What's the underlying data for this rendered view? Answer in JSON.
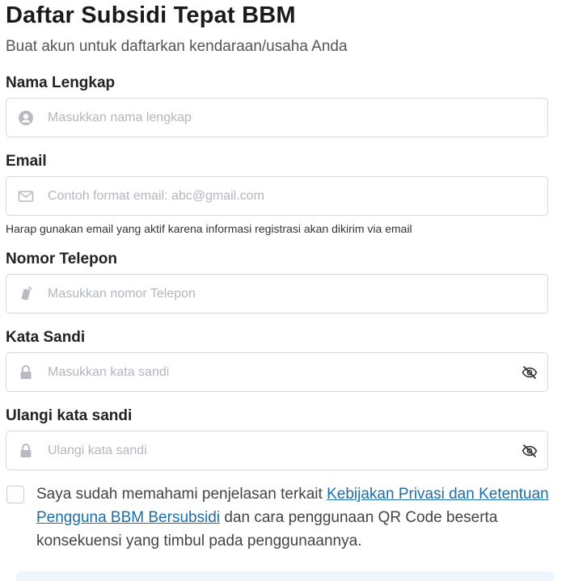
{
  "header": {
    "title": "Daftar Subsidi Tepat BBM",
    "subtitle": "Buat akun untuk daftarkan kendaraan/usaha Anda"
  },
  "form": {
    "full_name": {
      "label": "Nama Lengkap",
      "placeholder": "Masukkan nama lengkap",
      "icon": "user-circle-icon"
    },
    "email": {
      "label": "Email",
      "placeholder": "Contoh format email: abc@gmail.com",
      "icon": "envelope-icon",
      "hint": "Harap gunakan email yang aktif karena informasi registrasi akan dikirim via email"
    },
    "phone": {
      "label": "Nomor Telepon",
      "placeholder": "Masukkan nomor Telepon",
      "icon": "phone-icon"
    },
    "password": {
      "label": "Kata Sandi",
      "placeholder": "Masukkan kata sandi",
      "icon": "lock-icon",
      "toggle_icon": "eye-slash-icon"
    },
    "confirm_password": {
      "label": "Ulangi kata sandi",
      "placeholder": "Ulangi kata sandi",
      "icon": "lock-icon",
      "toggle_icon": "eye-slash-icon"
    }
  },
  "consent": {
    "text_before": "Saya sudah memahami penjelasan terkait ",
    "link_text": "Kebijakan Privasi dan Ketentuan Pengguna BBM Bersubsidi",
    "text_after": " dan cara penggunaan QR Code beserta konsekuensi yang timbul pada penggunaannya.",
    "checked": false
  },
  "colors": {
    "link": "#1b6ea8",
    "border": "#d6d8dc",
    "placeholder": "#b3b7bd",
    "icon": "#b8bcc2"
  }
}
